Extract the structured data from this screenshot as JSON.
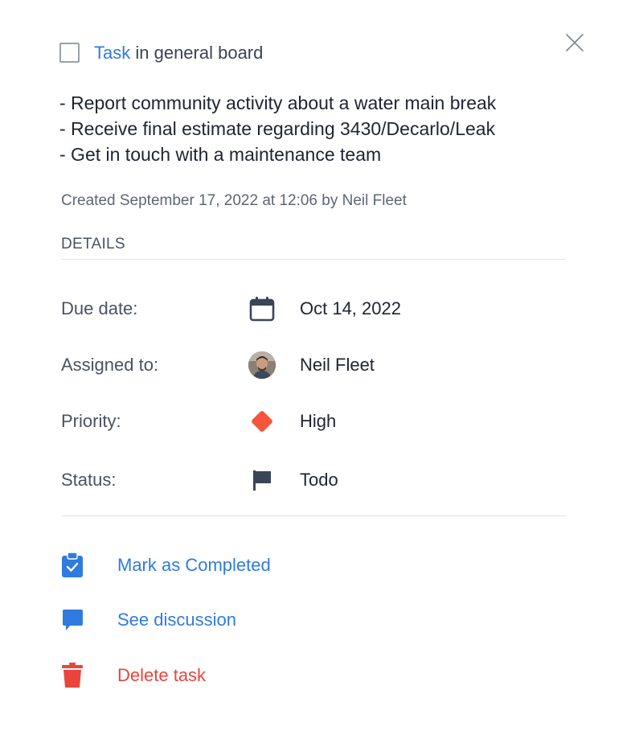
{
  "header": {
    "task_link": "Task",
    "board_text": " in general board"
  },
  "description": [
    "- Report community activity about a water main break",
    "- Receive final estimate regarding 3430/Decarlo/Leak",
    "- Get in touch with a maintenance team"
  ],
  "created": "Created September 17, 2022 at 12:06 by Neil Fleet",
  "details": {
    "title": "DETAILS",
    "due_date": {
      "label": "Due date:",
      "value": "Oct 14, 2022",
      "icon": "calendar-icon"
    },
    "assigned_to": {
      "label": "Assigned to:",
      "value": "Neil Fleet",
      "icon": "avatar"
    },
    "priority": {
      "label": "Priority:",
      "value": "High",
      "icon": "diamond-icon",
      "color": "#f4553d"
    },
    "status": {
      "label": "Status:",
      "value": "Todo",
      "icon": "flag-icon",
      "color": "#3a4559"
    }
  },
  "actions": {
    "complete": {
      "label": "Mark as Completed",
      "icon": "clipboard-check-icon",
      "color": "#2f7be0"
    },
    "discussion": {
      "label": "See discussion",
      "icon": "chat-bubble-icon",
      "color": "#2f7be0"
    },
    "delete": {
      "label": "Delete task",
      "icon": "trash-icon",
      "color": "#e8453c"
    }
  }
}
